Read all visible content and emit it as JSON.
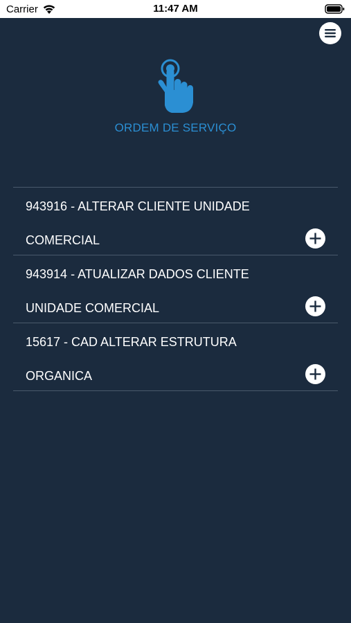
{
  "status_bar": {
    "carrier": "Carrier",
    "time": "11:47 AM",
    "wifi_icon": "wifi-icon",
    "battery_icon": "battery-icon"
  },
  "header": {
    "menu_icon": "menu-icon",
    "logo_icon": "tap-hand-icon",
    "title": "ORDEM DE SERVIÇO"
  },
  "colors": {
    "background": "#1b2b3e",
    "accent": "#2b8fd3",
    "divider": "#4a5a6c"
  },
  "orders": [
    {
      "line1": "943916 - ALTERAR CLIENTE UNIDADE",
      "line2": "COMERCIAL",
      "action_icon": "plus-icon"
    },
    {
      "line1": "943914 - ATUALIZAR DADOS CLIENTE",
      "line2": "UNIDADE COMERCIAL",
      "action_icon": "plus-icon"
    },
    {
      "line1": "15617 - CAD ALTERAR ESTRUTURA",
      "line2": "ORGANICA",
      "action_icon": "plus-icon"
    }
  ]
}
